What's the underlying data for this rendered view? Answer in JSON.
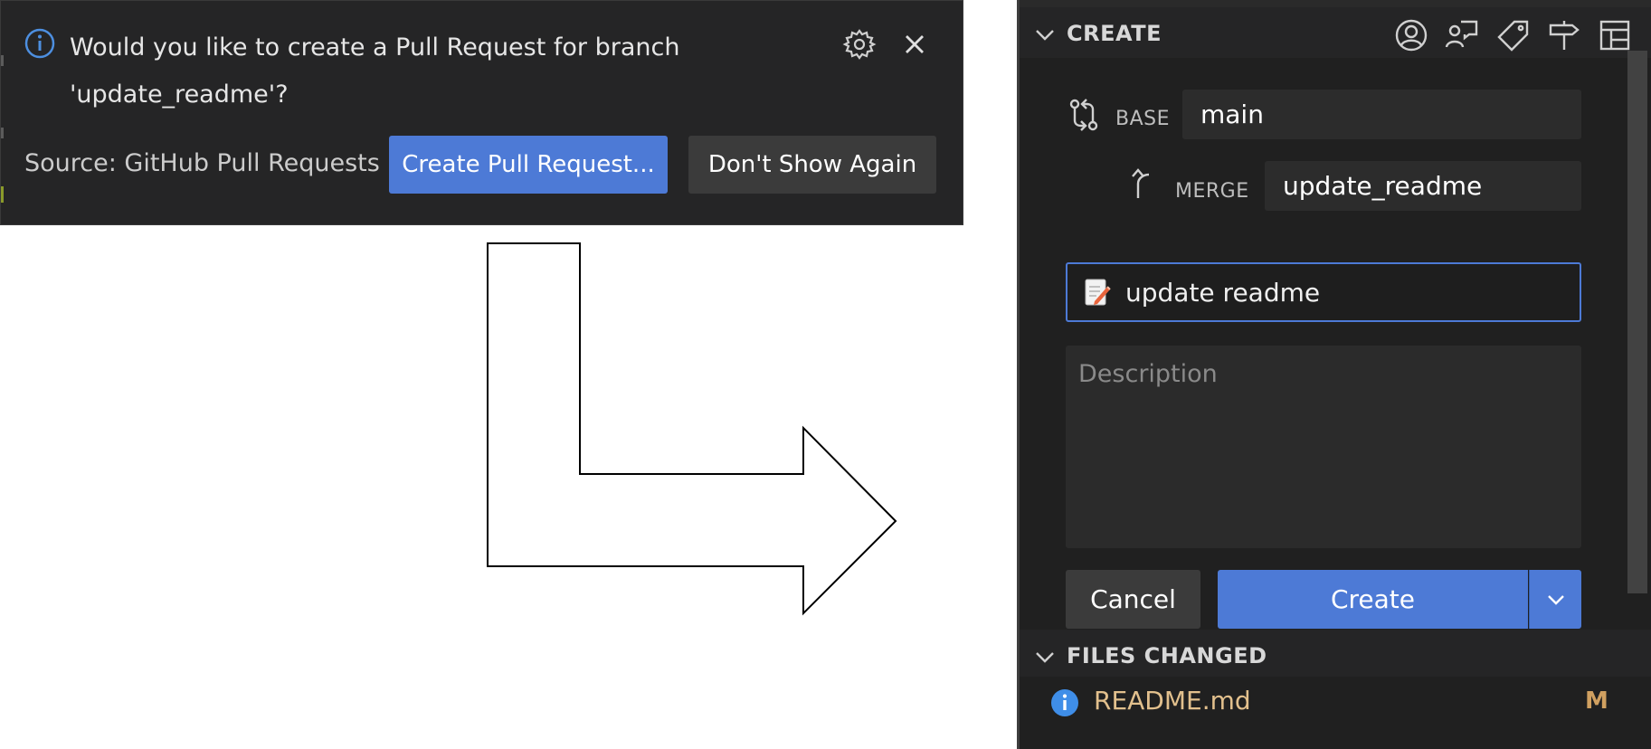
{
  "notification": {
    "message": "Would you like to create a Pull Request for branch 'update_readme'?",
    "source": "Source: GitHub Pull Requests",
    "primary_button": "Create Pull Request...",
    "secondary_button": "Don't Show Again"
  },
  "panel": {
    "create_header": "CREATE",
    "header_icons": [
      "account-icon",
      "comment-discussion-icon",
      "tag-icon",
      "milestone-icon",
      "project-icon"
    ],
    "base_label": "BASE",
    "base_value": "main",
    "merge_label": "MERGE",
    "merge_value": "update_readme",
    "title_value": "update readme",
    "description_placeholder": "Description",
    "cancel_label": "Cancel",
    "create_label": "Create",
    "files_header": "FILES CHANGED",
    "files": [
      {
        "name": "README.md",
        "status": "M"
      }
    ]
  },
  "colors": {
    "accent": "#4d7ad6",
    "toast_bg": "#252526",
    "panel_bg": "#202020",
    "modified_file": "#e2c08d"
  }
}
